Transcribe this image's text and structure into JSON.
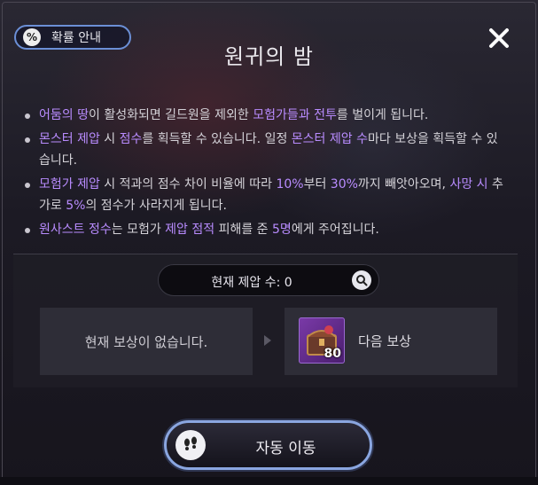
{
  "header": {
    "probability_button": "확률 안내",
    "title": "원귀의 밤"
  },
  "description": {
    "items": [
      [
        {
          "t": "어둠의 땅",
          "hl": true
        },
        {
          "t": "이 활성화되면 길드원을 제외한 ",
          "hl": false
        },
        {
          "t": "모험가들과 전투",
          "hl": true
        },
        {
          "t": "를 벌이게 됩니다.",
          "hl": false
        }
      ],
      [
        {
          "t": "몬스터 제압",
          "hl": true
        },
        {
          "t": " 시 ",
          "hl": false
        },
        {
          "t": "점수",
          "hl": true
        },
        {
          "t": "를 획득할 수 있습니다. 일정 ",
          "hl": false
        },
        {
          "t": "몬스터 제압 수",
          "hl": true
        },
        {
          "t": "마다 보상을 획득할 수 있습니다.",
          "hl": false
        }
      ],
      [
        {
          "t": "모험가 제압",
          "hl": true
        },
        {
          "t": " 시 적과의 점수 차이 비율에 따라 ",
          "hl": false
        },
        {
          "t": "10%",
          "hl": true
        },
        {
          "t": "부터 ",
          "hl": false
        },
        {
          "t": "30%",
          "hl": true
        },
        {
          "t": "까지 빼앗아오며, ",
          "hl": false
        },
        {
          "t": "사망 시",
          "hl": true
        },
        {
          "t": " 추가로 ",
          "hl": false
        },
        {
          "t": "5%",
          "hl": true
        },
        {
          "t": "의 점수가 사라지게 됩니다.",
          "hl": false
        }
      ],
      [
        {
          "t": "원사스트 정수",
          "hl": true
        },
        {
          "t": "는 모험가 ",
          "hl": false
        },
        {
          "t": "제압 점적",
          "hl": true
        },
        {
          "t": " 피해를 준 ",
          "hl": false
        },
        {
          "t": "5명",
          "hl": true
        },
        {
          "t": "에게 주어집니다.",
          "hl": false
        }
      ]
    ]
  },
  "status": {
    "count_label": "현재 제압 수: 0",
    "current_reward": "현재 보상이 없습니다.",
    "next_reward_label": "다음 보상",
    "next_reward_qty": "80"
  },
  "actions": {
    "auto_move": "자동 이동"
  },
  "colors": {
    "highlight": "#b98cff",
    "accent_border": "#8aa6e0"
  },
  "icons": [
    "percent-icon",
    "close-icon",
    "search-icon",
    "footprints-icon",
    "reward-chest-icon",
    "arrow-right-icon"
  ]
}
